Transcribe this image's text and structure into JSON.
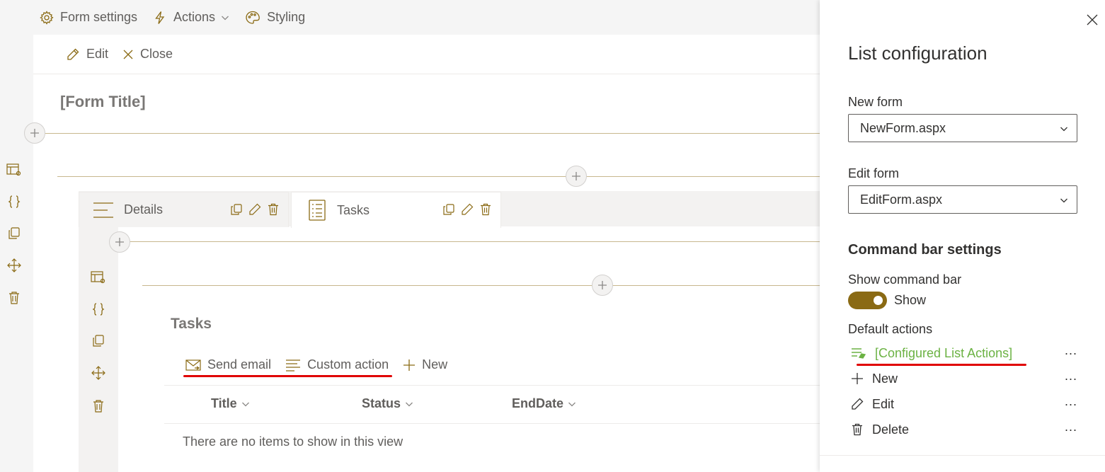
{
  "topbar": {
    "form_settings": "Form settings",
    "actions": "Actions",
    "styling": "Styling"
  },
  "command_bar": {
    "edit": "Edit",
    "close": "Close"
  },
  "form": {
    "title": "[Form Title]"
  },
  "tabs": [
    {
      "label": "Details",
      "selected": false
    },
    {
      "label": "Tasks",
      "selected": true
    }
  ],
  "list": {
    "title": "Tasks",
    "commands": [
      "Send email",
      "Custom action",
      "New"
    ],
    "columns": [
      "Title",
      "Status",
      "EndDate"
    ],
    "empty_message": "There are no items to show in this view"
  },
  "panel": {
    "title": "List configuration",
    "new_form_label": "New form",
    "new_form_value": "NewForm.aspx",
    "edit_form_label": "Edit form",
    "edit_form_value": "EditForm.aspx",
    "command_bar_heading": "Command bar settings",
    "show_command_bar_label": "Show command bar",
    "show_toggle_label": "Show",
    "show_toggle_on": true,
    "default_actions_label": "Default actions",
    "actions": [
      {
        "label": "[Configured List Actions]",
        "icon": "configured-actions-icon",
        "more": "..."
      },
      {
        "label": "New",
        "icon": "plus-icon",
        "more": "..."
      },
      {
        "label": "Edit",
        "icon": "pencil-icon",
        "more": "..."
      },
      {
        "label": "Delete",
        "icon": "trash-icon",
        "more": "..."
      }
    ]
  },
  "colors": {
    "accent_gold": "#8a6a14",
    "divider_gold": "#c8b78e",
    "highlight_green": "#6bb243",
    "annotation_red": "#e00000"
  }
}
